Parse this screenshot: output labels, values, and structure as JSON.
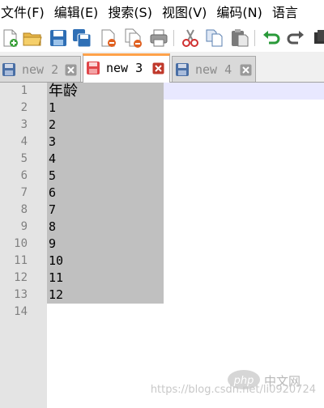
{
  "menu": {
    "items": [
      "文件(F)",
      "编辑(E)",
      "搜索(S)",
      "视图(V)",
      "编码(N)",
      "语言"
    ]
  },
  "toolbar": {
    "icons": [
      "new-file-icon",
      "open-file-icon",
      "save-icon",
      "save-all-icon",
      "close-icon",
      "close-all-icon",
      "print-icon",
      "cut-icon",
      "copy-icon",
      "paste-icon",
      "undo-icon",
      "redo-icon",
      "find-icon"
    ]
  },
  "tabs": [
    {
      "label": "new 2",
      "active": false
    },
    {
      "label": "new 3",
      "active": true
    },
    {
      "label": "new 4",
      "active": false
    }
  ],
  "editor": {
    "line_numbers": [
      "1",
      "2",
      "3",
      "4",
      "5",
      "6",
      "7",
      "8",
      "9",
      "10",
      "11",
      "12",
      "13",
      "14"
    ],
    "lines": [
      "年龄",
      "1",
      "2",
      "3",
      "4",
      "5",
      "6",
      "7",
      "8",
      "9",
      "10",
      "11",
      "12",
      ""
    ],
    "selected_lines": 13
  },
  "watermark": {
    "url": "https://blog.csdn.net/li0920724",
    "brand": "中文网"
  },
  "colors": {
    "active_tab_accent": "#ffa24a",
    "selection": "#c0c0c0",
    "current_line": "#e8e8ff",
    "gutter": "#e4e4e4"
  }
}
